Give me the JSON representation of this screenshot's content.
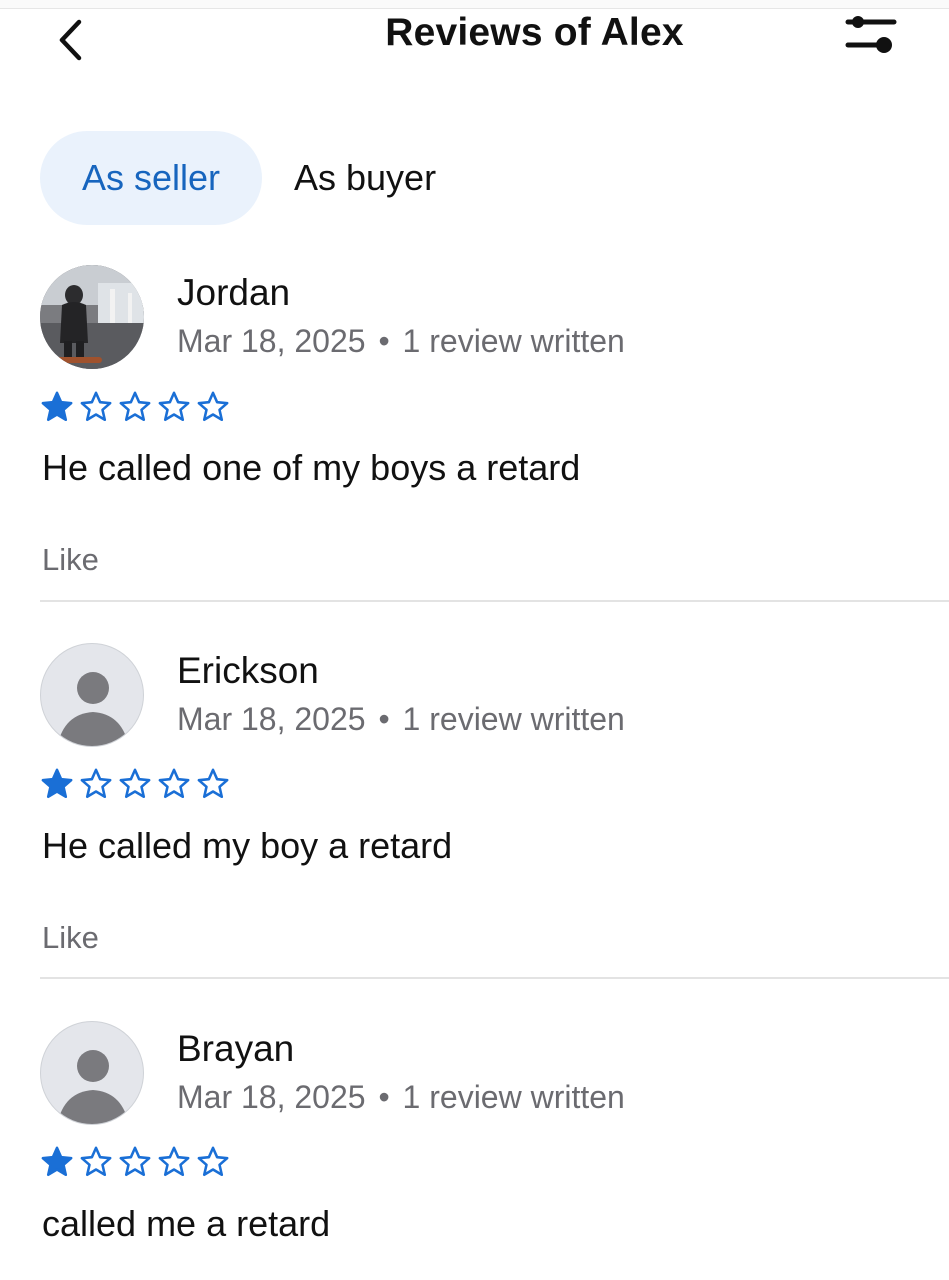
{
  "header": {
    "title": "Reviews of Alex",
    "back_icon": "chevron-left-icon",
    "filter_icon": "sliders-filter-icon"
  },
  "tabs": [
    {
      "label": "As seller",
      "active": true
    },
    {
      "label": "As buyer",
      "active": false
    }
  ],
  "colors": {
    "accent": "#1765be",
    "tab_active_bg": "#eaf2fc",
    "star": "#1a6fd6",
    "secondary_text": "#6b6b70"
  },
  "reviews": [
    {
      "name": "Jordan",
      "date": "Mar 18, 2025",
      "meta_separator": "•",
      "review_count_text": "1 review written",
      "rating": 1,
      "rating_max": 5,
      "text": "He called one of my boys a retard",
      "like_label": "Like",
      "avatar": "photo"
    },
    {
      "name": "Erickson",
      "date": "Mar 18, 2025",
      "meta_separator": "•",
      "review_count_text": "1 review written",
      "rating": 1,
      "rating_max": 5,
      "text": "He called my boy a retard",
      "like_label": "Like",
      "avatar": "default-person-icon"
    },
    {
      "name": "Brayan",
      "date": "Mar 18, 2025",
      "meta_separator": "•",
      "review_count_text": "1 review written",
      "rating": 1,
      "rating_max": 5,
      "text": "called me a retard",
      "like_label": "Like",
      "avatar": "default-person-icon"
    }
  ]
}
